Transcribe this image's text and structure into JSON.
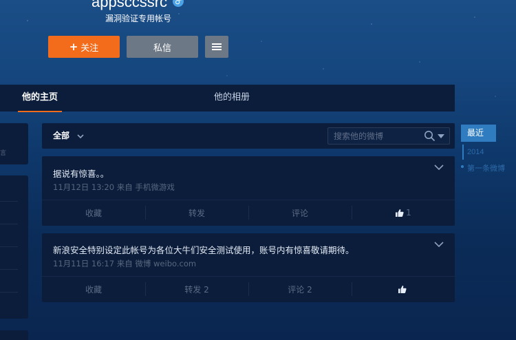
{
  "profile": {
    "name": "appsccssrc",
    "gender_icon": "male-icon",
    "description": "漏洞验证专用帐号",
    "follow_label": "关注",
    "message_label": "私信"
  },
  "tabs": {
    "home": "他的主页",
    "album": "他的相册"
  },
  "feed": {
    "filter_label": "全部",
    "search_placeholder": "搜索他的微博"
  },
  "timeline": {
    "recent": "最近",
    "year": "2014",
    "first": "第一条微博"
  },
  "posts": [
    {
      "text": "据说有惊喜。。",
      "meta": "11月12日 13:20 来自 手机微游戏",
      "favorite": "收藏",
      "repost": "转发",
      "comment": "评论",
      "likes": "1"
    },
    {
      "text": "新浪安全特别设定此帐号为各位大牛们安全测试使用，账号内有惊喜敬请期待。",
      "meta": "11月11日 16:17 来自 微博 weibo.com",
      "favorite": "收藏",
      "repost": "转发 2",
      "comment": "评论 2",
      "likes": ""
    }
  ],
  "colors": {
    "accent": "#f26c1b",
    "timeline": "#2f7dc0",
    "panel": "#0b1d3b"
  }
}
